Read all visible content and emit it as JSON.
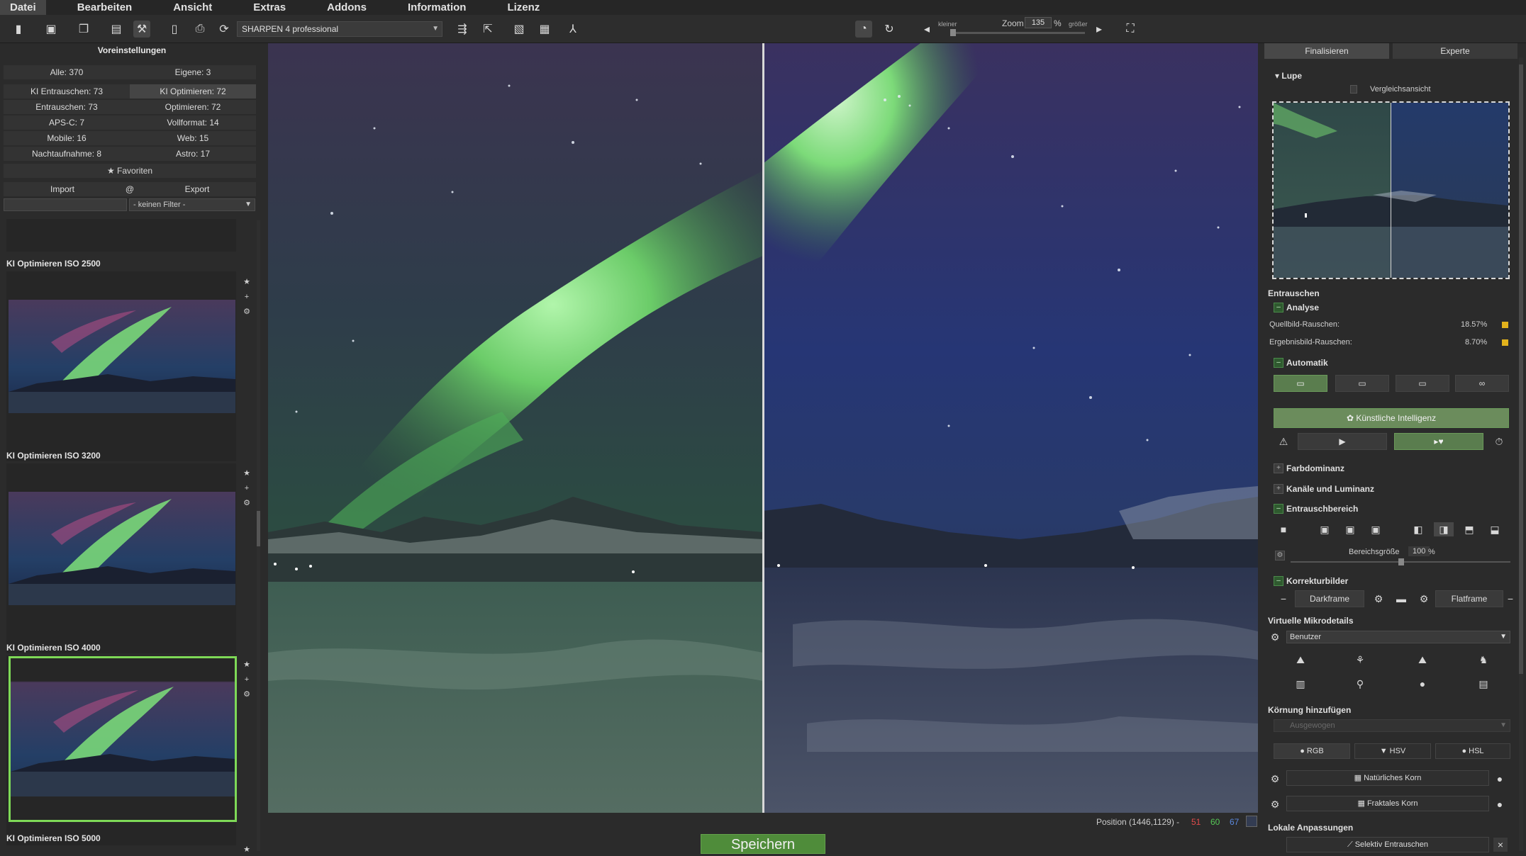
{
  "menu": {
    "items": [
      "Datei",
      "Bearbeiten",
      "Ansicht",
      "Extras",
      "Addons",
      "Information",
      "Lizenz"
    ]
  },
  "toolbar": {
    "preset_value": "SHARPEN 4 professional",
    "zoom_small": "kleiner",
    "zoom_label": "Zoom",
    "zoom_value": "135",
    "zoom_unit": "%",
    "zoom_large": "größer"
  },
  "left": {
    "title": "Voreinstellungen",
    "counts": {
      "all": "Alle: 370",
      "own": "Eigene: 3",
      "ki_denoise": "KI Entrauschen: 73",
      "ki_optimize": "KI Optimieren: 72",
      "denoise": "Entrauschen: 73",
      "optimize": "Optimieren: 72",
      "apsc": "APS-C: 7",
      "fullframe": "Vollformat: 14",
      "mobile": "Mobile: 16",
      "web": "Web: 15",
      "night": "Nachtaufnahme: 8",
      "astro": "Astro: 17"
    },
    "favorites": "★ Favoriten",
    "import": "Import",
    "at": "@",
    "export": "Export",
    "filter": "- keinen Filter -",
    "presets": [
      {
        "name": "KI Optimieren ISO 2500"
      },
      {
        "name": "KI Optimieren ISO 3200"
      },
      {
        "name": "KI Optimieren ISO 4000"
      },
      {
        "name": "KI Optimieren ISO 5000"
      }
    ]
  },
  "status": {
    "position": "Position  (1446,1129)  -",
    "r": "51",
    "g": "60",
    "b": "67",
    "save": "Speichern"
  },
  "right": {
    "tabs": [
      "Finalisieren",
      "Experte"
    ],
    "lupe": "▾ Lupe",
    "compare": "Vergleichsansicht",
    "denoise_title": "Entrauschen",
    "analysis": "Analyse",
    "source_noise_label": "Quellbild-Rauschen:",
    "source_noise_value": "18.57%",
    "result_noise_label": "Ergebnisbild-Rauschen:",
    "result_noise_value": "8.70%",
    "auto": "Automatik",
    "ai_button": "Künstliche Intelligenz",
    "color_dominance": "Farbdominanz",
    "channels": "Kanäle und Luminanz",
    "denoise_area": "Entrauschbereich",
    "area_size_label": "Bereichsgröße",
    "area_size_value": "100",
    "area_size_unit": "%",
    "correction_images": "Korrekturbilder",
    "darkframe": "Darkframe",
    "flatframe": "Flatframe",
    "microdetails": "Virtuelle Mikrodetails",
    "micro_select": "Benutzer",
    "grain_title": "Körnung hinzufügen",
    "grain_select": "Ausgewogen",
    "rgb": "RGB",
    "hsv": "HSV",
    "hsl": "HSL",
    "natural_grain": "Natürliches Korn",
    "fractal_grain": "Fraktales Korn",
    "local_adjust": "Lokale Anpassungen",
    "selective_denoise": "Selektiv Entrauschen"
  }
}
